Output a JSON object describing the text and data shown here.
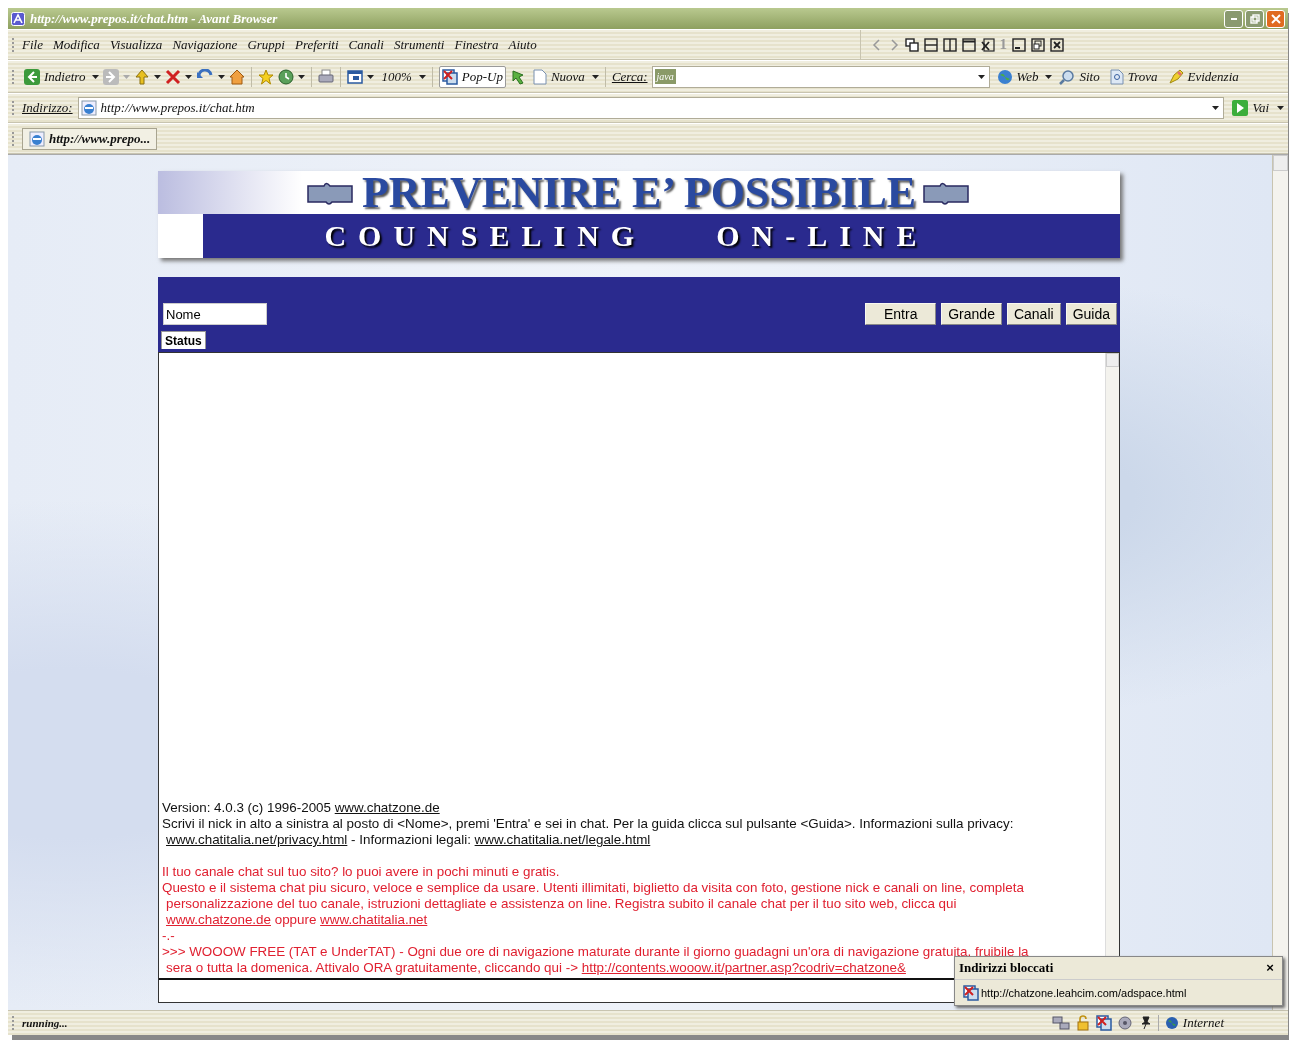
{
  "window": {
    "title": "http://www.prepos.it/chat.htm - Avant Browser"
  },
  "menu": [
    "File",
    "Modifica",
    "Visualizza",
    "Navigazione",
    "Gruppi",
    "Preferiti",
    "Canali",
    "Strumenti",
    "Finestra",
    "Aiuto"
  ],
  "window_tools": {
    "count": "1"
  },
  "toolbar": {
    "back": "Indietro",
    "zoom": "100%",
    "popup": "Pop-Up",
    "new": "Nuova",
    "search_label": "Cerca:",
    "search_value": "java",
    "web": "Web",
    "site": "Sito",
    "find": "Trova",
    "highlight": "Evidenzia"
  },
  "address": {
    "label": "Indirizzo:",
    "value": "http://www.prepos.it/chat.htm",
    "go": "Vai"
  },
  "tabs": [
    {
      "label": "http://www.prepo...",
      "selected": true
    }
  ],
  "page": {
    "banner": {
      "title": "PREVENIRE E’ POSSIBILE",
      "subtitle_1": "COUNSELING",
      "subtitle_2": "ON-LINE"
    },
    "chat": {
      "nick": {
        "value": "Nome"
      },
      "buttons": [
        "Entra",
        "Grande",
        "Canali",
        "Guida"
      ],
      "status_tab": "Status",
      "paragraphs": [
        {
          "kind": "notice",
          "lines": [
            {
              "wrapped": false,
              "segments": [
                {
                  "text": "Version: 4.0.3 (c) 1996-2005 ",
                  "link": false
                },
                {
                  "text": "www.chatzone.de",
                  "link": true
                }
              ]
            },
            {
              "wrapped": false,
              "segments": [
                {
                  "text": "Scrivi il nick in alto a sinistra al posto di <Nome>, premi 'Entra' e sei in chat. Per la guida clicca sul pulsante <Guida>. Informazioni sulla privacy:",
                  "link": false
                }
              ]
            },
            {
              "wrapped": true,
              "segments": [
                {
                  "text": "www.chatitalia.net/privacy.html",
                  "link": true
                },
                {
                  "text": " - Informazioni legali: ",
                  "link": false
                },
                {
                  "text": "www.chatitalia.net/legale.html",
                  "link": true
                }
              ]
            }
          ]
        },
        {
          "kind": "promo",
          "lines": [
            {
              "wrapped": false,
              "segments": [
                {
                  "text": "Il tuo canale chat sul tuo sito? lo puoi avere in pochi minuti e gratis.",
                  "link": false
                }
              ]
            },
            {
              "wrapped": false,
              "segments": [
                {
                  "text": "Questo e il sistema chat piu sicuro, veloce e semplice da usare. Utenti illimitati, biglietto da visita con foto, gestione nick e canali on line, completa",
                  "link": false
                }
              ]
            },
            {
              "wrapped": true,
              "segments": [
                {
                  "text": "personalizzazione del tuo canale, istruzioni dettagliate e assistenza on line. Registra subito il canale chat per il tuo sito web, clicca qui",
                  "link": false
                }
              ]
            },
            {
              "wrapped": true,
              "segments": [
                {
                  "text": "www.chatzone.de",
                  "link": true
                },
                {
                  "text": " oppure ",
                  "link": false
                },
                {
                  "text": "www.chatitalia.net",
                  "link": true
                }
              ]
            }
          ]
        },
        {
          "kind": "promo",
          "lines": [
            {
              "wrapped": false,
              "segments": [
                {
                  "text": "-.-",
                  "link": false
                }
              ]
            }
          ]
        },
        {
          "kind": "promo",
          "lines": [
            {
              "wrapped": false,
              "segments": [
                {
                  "text": ">>> WOOOW FREE (TAT e UnderTAT) - Ogni due ore di navigazione maturate durante il giorno guadagni un'ora di navigazione gratuita, fruibile la",
                  "link": false
                }
              ]
            },
            {
              "wrapped": true,
              "segments": [
                {
                  "text": "sera o tutta la domenica. Attivalo ORA gratuitamente, cliccando qui -> ",
                  "link": false
                },
                {
                  "text": "http://contents.wooow.it/partner.asp?codriv=chatzone&",
                  "link": true
                }
              ]
            }
          ]
        }
      ]
    }
  },
  "popup": {
    "title": "Indirizzi bloccati",
    "close": "×",
    "url": "http://chatzone.leahcim.com/adspace.html"
  },
  "status_bar": {
    "text": "running...",
    "zone": "Internet"
  }
}
